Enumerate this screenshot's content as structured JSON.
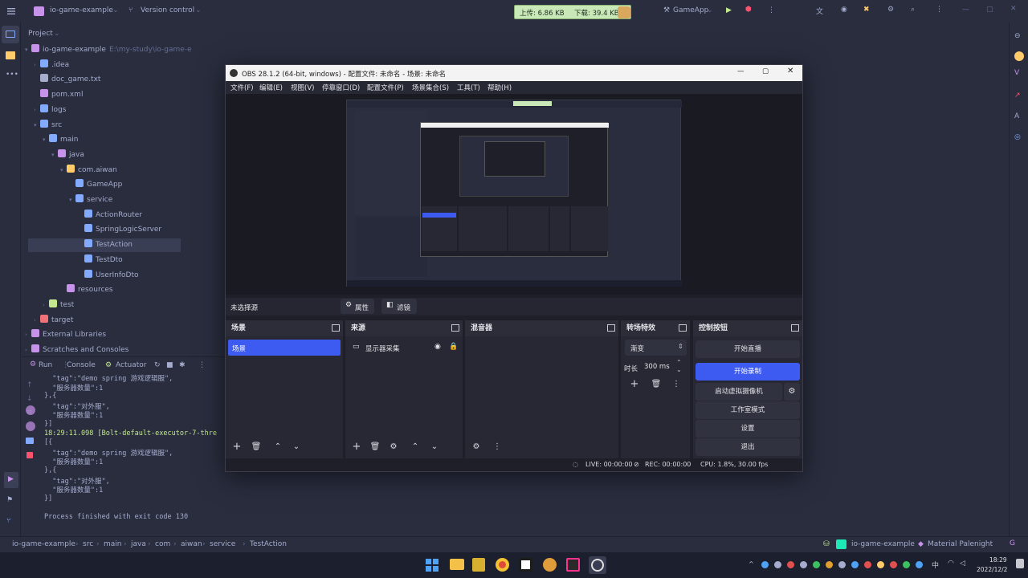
{
  "ide": {
    "project_name": "io-game-example",
    "vcs": "Version control",
    "net_up": "上传: 6.86 KB",
    "net_down": "下载: 39.4 KB",
    "run_config": "GameApp",
    "project_label": "Project",
    "tree": [
      {
        "label": "io-game-example",
        "extra": "E:\\my-study\\io-game-e",
        "depth": 0,
        "arrow": "▾",
        "color": "#c792ea"
      },
      {
        "label": ".idea",
        "depth": 1,
        "arrow": "›",
        "color": "#82aaff"
      },
      {
        "label": "doc_game.txt",
        "depth": 1,
        "arrow": "",
        "color": "#a6accd"
      },
      {
        "label": "pom.xml",
        "depth": 1,
        "arrow": "",
        "color": "#c792ea"
      },
      {
        "label": "logs",
        "depth": 1,
        "arrow": "›",
        "color": "#82aaff"
      },
      {
        "label": "src",
        "depth": 1,
        "arrow": "▾",
        "color": "#82aaff"
      },
      {
        "label": "main",
        "depth": 2,
        "arrow": "▾",
        "color": "#82aaff"
      },
      {
        "label": "java",
        "depth": 3,
        "arrow": "▾",
        "color": "#c792ea"
      },
      {
        "label": "com.aiwan",
        "depth": 4,
        "arrow": "▾",
        "color": "#ffcb6b"
      },
      {
        "label": "GameApp",
        "depth": 5,
        "arrow": "",
        "color": "#82aaff"
      },
      {
        "label": "service",
        "depth": 5,
        "arrow": "▾",
        "color": "#82aaff"
      },
      {
        "label": "ActionRouter",
        "depth": 6,
        "arrow": "",
        "color": "#82aaff"
      },
      {
        "label": "SpringLogicServer",
        "depth": 6,
        "arrow": "",
        "color": "#82aaff"
      },
      {
        "label": "TestAction",
        "depth": 6,
        "arrow": "",
        "color": "#82aaff",
        "selected": true
      },
      {
        "label": "TestDto",
        "depth": 6,
        "arrow": "",
        "color": "#82aaff"
      },
      {
        "label": "UserInfoDto",
        "depth": 6,
        "arrow": "",
        "color": "#82aaff"
      },
      {
        "label": "resources",
        "depth": 4,
        "arrow": "",
        "color": "#c792ea"
      },
      {
        "label": "test",
        "depth": 2,
        "arrow": "›",
        "color": "#c3e88d"
      },
      {
        "label": "target",
        "depth": 1,
        "arrow": "›",
        "color": "#f07178"
      },
      {
        "label": "External Libraries",
        "depth": 0,
        "arrow": "›",
        "color": "#c792ea"
      },
      {
        "label": "Scratches and Consoles",
        "depth": 0,
        "arrow": "›",
        "color": "#c792ea"
      }
    ],
    "run_tabs": {
      "run": "Run",
      "console": "Console",
      "actuator": "Actuator"
    },
    "console_lines": [
      "  \"tag\":\"demo spring 游戏逻辑服\",",
      "  \"服务器数量\":1",
      "},{",
      "  \"tag\":\"对外服\",",
      "  \"服务器数量\":1",
      "}]",
      "18:29:11.098 [Bolt-default-executor-7-thre",
      "[{",
      "  \"tag\":\"demo spring 游戏逻辑服\",",
      "  \"服务器数量\":1",
      "},{",
      "  \"tag\":\"对外服\",",
      "  \"服务器数量\":1",
      "}]",
      "",
      "Process finished with exit code 130"
    ],
    "breadcrumb": [
      "io-game-example",
      "src",
      "main",
      "java",
      "com",
      "aiwan",
      "service",
      "TestAction"
    ],
    "status_project": "io-game-example",
    "theme": "Material Palenight",
    "clock_time": "18:29",
    "clock_date": "2022/12/2"
  },
  "obs": {
    "title": "OBS 28.1.2 (64-bit, windows) - 配置文件: 未命名 - 场景: 未命名",
    "menu": [
      "文件(F)",
      "编辑(E)",
      "视图(V)",
      "停靠窗口(D)",
      "配置文件(P)",
      "场景集合(S)",
      "工具(T)",
      "帮助(H)"
    ],
    "no_source": "未选择源",
    "properties": "属性",
    "filters": "滤镜",
    "docks": {
      "scenes": "场景",
      "sources": "来源",
      "mixer": "混音器",
      "transitions": "转场特效",
      "controls": "控制按钮"
    },
    "scene_item": "场景",
    "source_item": "显示器采集",
    "transition_type": "渐变",
    "duration_label": "时长",
    "duration_value": "300 ms",
    "controls": {
      "stream": "开始直播",
      "record": "开始录制",
      "vcam": "启动虚拟摄像机",
      "studio": "工作室模式",
      "settings": "设置",
      "exit": "退出"
    },
    "status": {
      "live": "LIVE: 00:00:00",
      "rec": "REC: 00:00:00",
      "cpu": "CPU: 1.8%, 30.00 fps"
    }
  },
  "colors": {
    "ide_bg": "#292d3e",
    "accent": "#3d5af1",
    "obs_bg": "#1e1f28"
  }
}
